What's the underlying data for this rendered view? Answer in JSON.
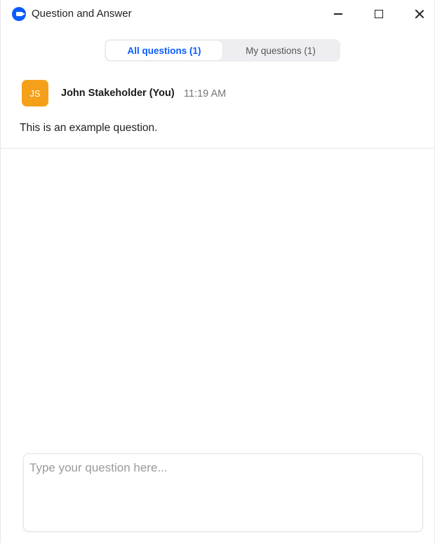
{
  "window": {
    "title": "Question and Answer",
    "icon": "zoom-camera-icon"
  },
  "tabs": [
    {
      "label": "All questions (1)",
      "active": true
    },
    {
      "label": "My questions (1)",
      "active": false
    }
  ],
  "questions": [
    {
      "initials": "JS",
      "author": "John Stakeholder (You)",
      "time": "11:19 AM",
      "text": "This is an example question."
    }
  ],
  "input": {
    "placeholder": "Type your question here...",
    "value": ""
  },
  "colors": {
    "accent": "#0b5cff",
    "avatar": "#f5a01a"
  }
}
